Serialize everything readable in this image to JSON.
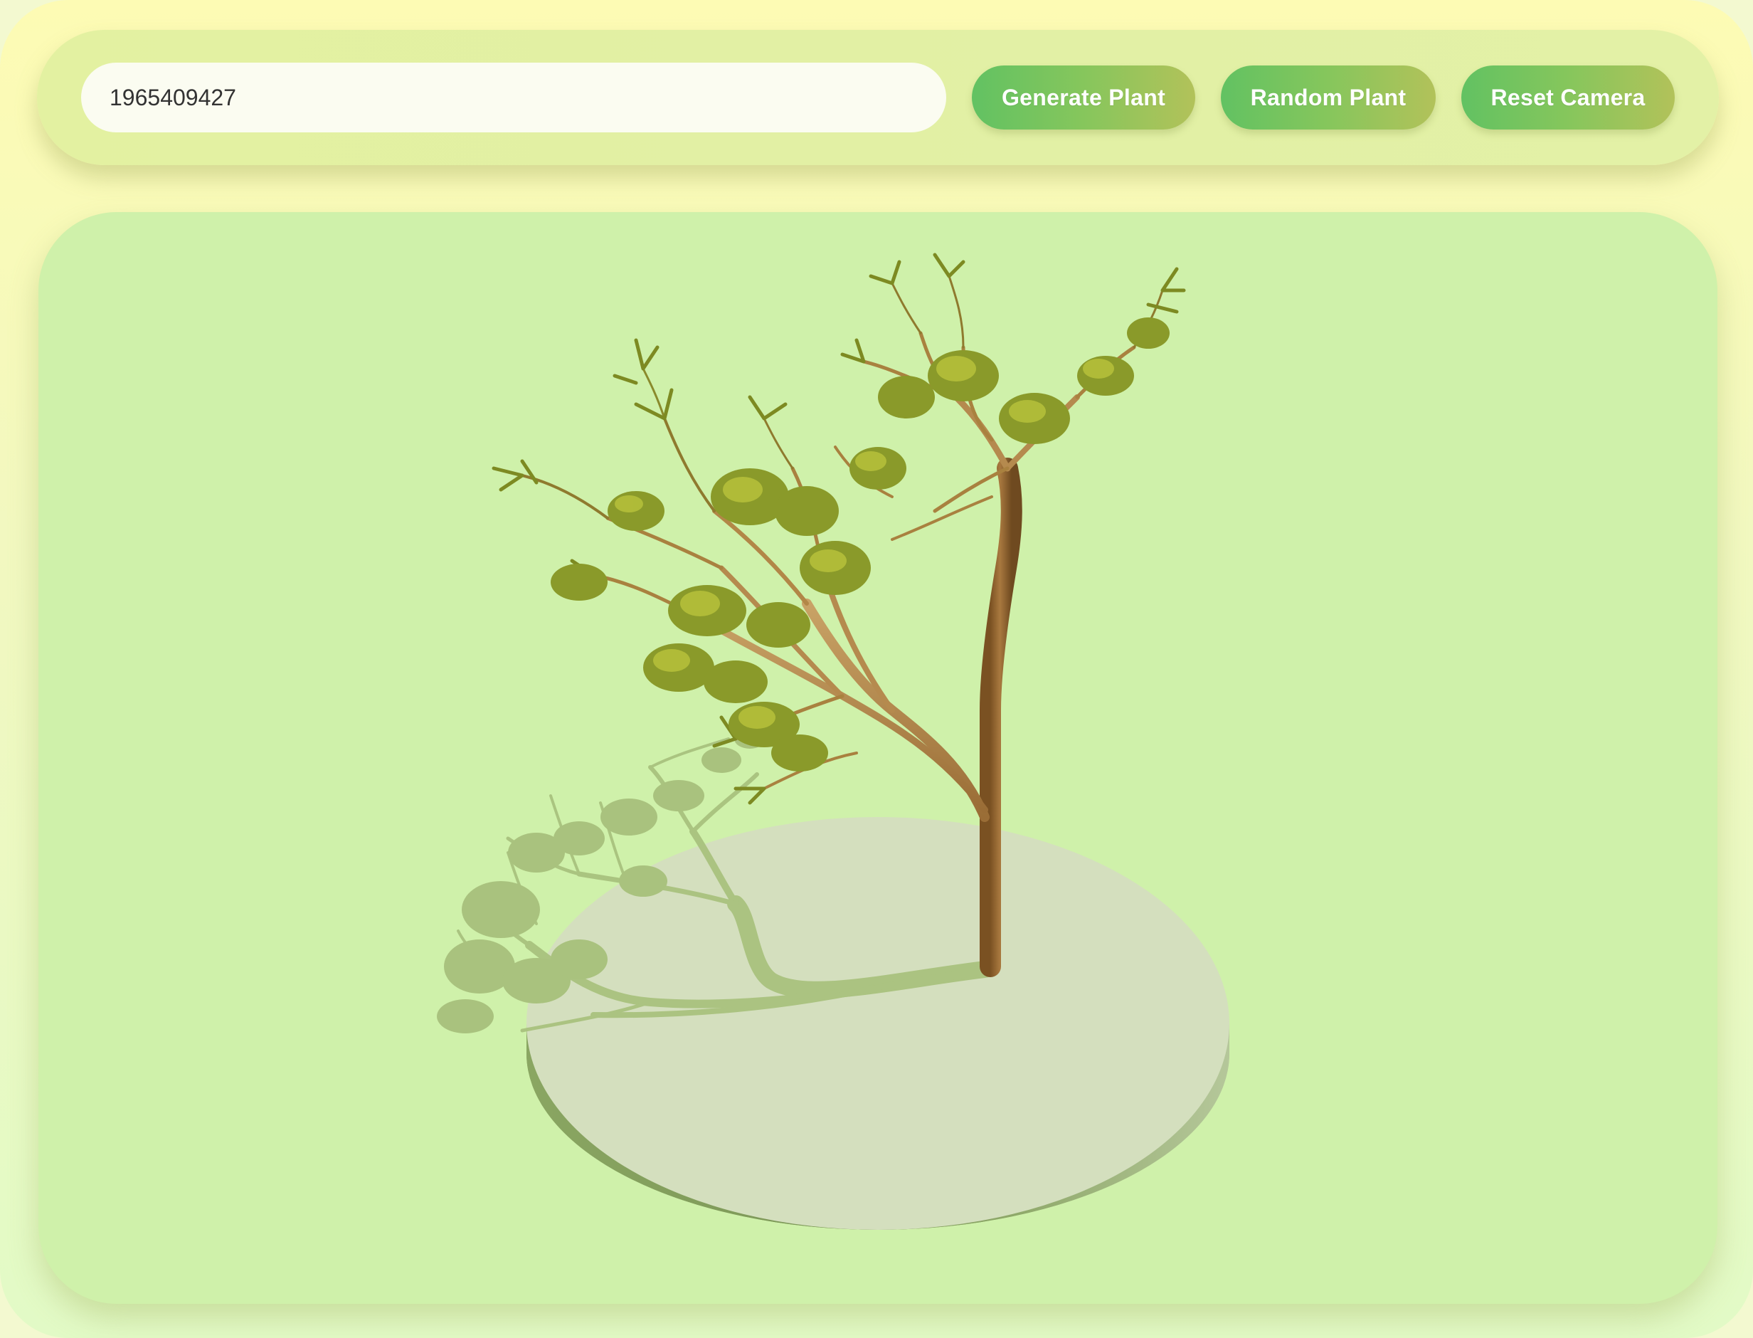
{
  "toolbar": {
    "seed_value": "1965409427",
    "generate_label": "Generate Plant",
    "random_label": "Random Plant",
    "reset_label": "Reset Camera"
  },
  "colors": {
    "viewport_bg": "#cff1aa",
    "platform_top": "#d4dfbe",
    "platform_side": "#7a9456",
    "trunk": "#9a6b3a",
    "foliage": "#8a9a2a",
    "button_gradient_start": "#62c262",
    "button_gradient_end": "#b2c25a"
  }
}
